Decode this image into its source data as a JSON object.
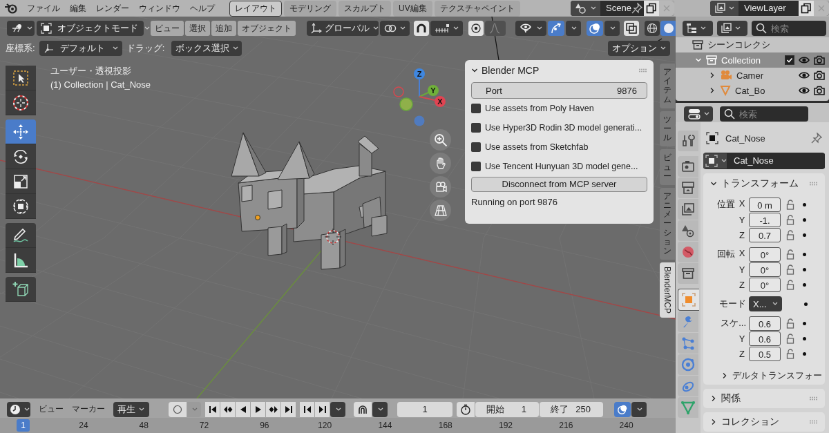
{
  "menu_bar": [
    "ファイル",
    "編集",
    "レンダー",
    "ウィンドウ",
    "ヘルプ"
  ],
  "workspace_tabs": [
    {
      "label": "レイアウト",
      "selected": true
    },
    {
      "label": "モデリング",
      "selected": false
    },
    {
      "label": "スカルプト",
      "selected": false
    },
    {
      "label": "UV編集",
      "selected": false
    },
    {
      "label": "テクスチャペイント",
      "selected": false
    }
  ],
  "scene": "Scene",
  "view_layer": "ViewLayer",
  "viewport_header": {
    "mode": "オブジェクトモード",
    "menus": [
      "ビュー",
      "選択",
      "追加",
      "オブジェクト"
    ],
    "orientation": "グローバル"
  },
  "tool_settings": {
    "coordinate_label": "座標系:",
    "coordinate_value": "デフォルト",
    "drag_label": "ドラッグ:",
    "drag_value": "ボックス選択",
    "options": "オプション"
  },
  "viewport": {
    "view_name": "ユーザー・透視投影",
    "object_info": "(1) Collection | Cat_Nose",
    "gizmo": [
      "Z",
      "Y",
      "X"
    ]
  },
  "toolbar": [
    {
      "kind": "select",
      "selected": false
    },
    {
      "kind": "cursor",
      "selected": false
    },
    {
      "kind": "move",
      "selected": true
    },
    {
      "kind": "rotate",
      "selected": false
    },
    {
      "kind": "scale",
      "selected": false
    },
    {
      "kind": "transform",
      "selected": false
    },
    {
      "kind": "annotate",
      "selected": false
    },
    {
      "kind": "measure",
      "selected": false
    },
    {
      "kind": "add_cube",
      "selected": false
    }
  ],
  "mcp_panel": {
    "title": "Blender MCP",
    "expanded": true,
    "port_label": "Port",
    "port_value": "9876",
    "options": [
      {
        "label": "Use assets from Poly Haven",
        "checked": false
      },
      {
        "label": "Use Hyper3D Rodin 3D model generati...",
        "checked": false
      },
      {
        "label": "Use assets from Sketchfab",
        "checked": false
      },
      {
        "label": "Use Tencent Hunyuan 3D model gene...",
        "checked": false
      }
    ],
    "button": "Disconnect from MCP server",
    "status": "Running on port 9876"
  },
  "sidebar_tabs": [
    {
      "label": "アイテム",
      "selected": false,
      "kind": "vertical"
    },
    {
      "label": "ツール",
      "selected": false,
      "kind": "vertical"
    },
    {
      "label": "ビュー",
      "selected": false,
      "kind": "vertical"
    },
    {
      "label": "アニメーション",
      "selected": false,
      "kind": "vertical"
    },
    {
      "label": "BlenderMCP",
      "selected": true,
      "kind": "rotated"
    }
  ],
  "outliner": {
    "search_placeholder": "検索",
    "tree": [
      {
        "label": "シーンコレクシ",
        "kind": "scene_collection",
        "selected": false,
        "children": [
          {
            "label": "Collection",
            "kind": "collection",
            "selected": true,
            "expanded": true,
            "checked": true,
            "children": [
              {
                "label": "Camer",
                "kind": "camera",
                "selected": false,
                "expanded": false
              },
              {
                "label": "Cat_Bo",
                "kind": "mesh",
                "selected": false,
                "expanded": false
              }
            ]
          }
        ]
      }
    ]
  },
  "properties": {
    "search_placeholder": "検索",
    "tabs": [
      {
        "kind": "tool",
        "selected": false
      },
      {
        "kind": "render",
        "selected": false
      },
      {
        "kind": "output",
        "selected": false
      },
      {
        "kind": "view_layer",
        "selected": false
      },
      {
        "kind": "scene",
        "selected": false
      },
      {
        "kind": "world",
        "selected": false
      },
      {
        "kind": "collection",
        "selected": false
      },
      {
        "kind": "object",
        "selected": true
      },
      {
        "kind": "modifier",
        "selected": false
      },
      {
        "kind": "particles",
        "selected": false
      },
      {
        "kind": "physics",
        "selected": false
      },
      {
        "kind": "constraints",
        "selected": false
      },
      {
        "kind": "data",
        "selected": false
      }
    ],
    "object_name": "Cat_Nose",
    "data_name": "Cat_Nose",
    "transform": {
      "title": "トランスフォーム",
      "expanded": true,
      "rows": [
        {
          "label": "位置",
          "axis": "X",
          "value": "0 m",
          "kind": "field"
        },
        {
          "axis": "Y",
          "value": "-1.",
          "kind": "field"
        },
        {
          "axis": "Z",
          "value": "0.7",
          "kind": "field"
        },
        {
          "label": "回転",
          "axis": "X",
          "value": "0°",
          "kind": "field"
        },
        {
          "axis": "Y",
          "value": "0°",
          "kind": "field"
        },
        {
          "axis": "Z",
          "value": "0°",
          "kind": "field"
        },
        {
          "label": "モード",
          "value": "X...",
          "kind": "dropdown"
        },
        {
          "label": "スケ...",
          "value": "0.6",
          "kind": "field"
        },
        {
          "axis": "Y",
          "value": "0.6",
          "kind": "field"
        },
        {
          "axis": "Z",
          "value": "0.5",
          "kind": "field"
        }
      ],
      "subpanel": {
        "title": "デルタトランスフォー",
        "expanded": false
      }
    },
    "panels": [
      {
        "title": "関係",
        "expanded": false
      },
      {
        "title": "コレクション",
        "expanded": false
      }
    ]
  },
  "timeline": {
    "menus": [
      "ビュー",
      "マーカー"
    ],
    "playback": "再生",
    "current_frame": "1",
    "start_label": "開始",
    "start": "1",
    "end_label": "終了",
    "end": "250",
    "ruler": [
      {
        "label": "1",
        "selected": true
      },
      {
        "label": "24",
        "selected": false
      },
      {
        "label": "48",
        "selected": false
      },
      {
        "label": "72",
        "selected": false
      },
      {
        "label": "96",
        "selected": false
      },
      {
        "label": "120",
        "selected": false
      },
      {
        "label": "144",
        "selected": false
      },
      {
        "label": "168",
        "selected": false
      },
      {
        "label": "192",
        "selected": false
      },
      {
        "label": "216",
        "selected": false
      },
      {
        "label": "240",
        "selected": false
      }
    ]
  }
}
